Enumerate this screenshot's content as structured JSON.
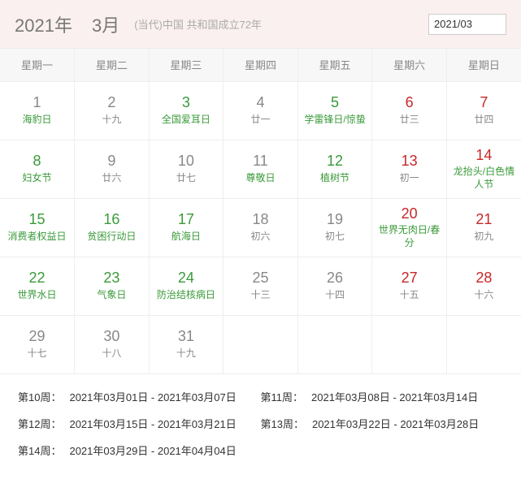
{
  "header": {
    "year": "2021年",
    "month": "3月",
    "subtitle": "(当代)中国 共和国成立72年",
    "input_value": "2021/03"
  },
  "weekdays": [
    "星期一",
    "星期二",
    "星期三",
    "星期四",
    "星期五",
    "星期六",
    "星期日"
  ],
  "rows": [
    [
      {
        "n": "1",
        "nc": "dark",
        "s": "海豹日",
        "sc": "green"
      },
      {
        "n": "2",
        "nc": "dark",
        "s": "十九",
        "sc": "dark"
      },
      {
        "n": "3",
        "nc": "green",
        "s": "全国爱耳日",
        "sc": "green"
      },
      {
        "n": "4",
        "nc": "dark",
        "s": "廿一",
        "sc": "dark"
      },
      {
        "n": "5",
        "nc": "green",
        "s": "学雷锋日/惊蛰",
        "sc": "green"
      },
      {
        "n": "6",
        "nc": "red",
        "s": "廿三",
        "sc": "dark"
      },
      {
        "n": "7",
        "nc": "red",
        "s": "廿四",
        "sc": "dark"
      }
    ],
    [
      {
        "n": "8",
        "nc": "green",
        "s": "妇女节",
        "sc": "green"
      },
      {
        "n": "9",
        "nc": "dark",
        "s": "廿六",
        "sc": "dark"
      },
      {
        "n": "10",
        "nc": "dark",
        "s": "廿七",
        "sc": "dark"
      },
      {
        "n": "11",
        "nc": "dark",
        "s": "尊敬日",
        "sc": "green"
      },
      {
        "n": "12",
        "nc": "green",
        "s": "植树节",
        "sc": "green"
      },
      {
        "n": "13",
        "nc": "red",
        "s": "初一",
        "sc": "dark"
      },
      {
        "n": "14",
        "nc": "red",
        "s": "龙抬头/白色情人节",
        "sc": "green"
      }
    ],
    [
      {
        "n": "15",
        "nc": "green",
        "s": "消费者权益日",
        "sc": "green"
      },
      {
        "n": "16",
        "nc": "green",
        "s": "贫困行动日",
        "sc": "green"
      },
      {
        "n": "17",
        "nc": "green",
        "s": "航海日",
        "sc": "green"
      },
      {
        "n": "18",
        "nc": "dark",
        "s": "初六",
        "sc": "dark"
      },
      {
        "n": "19",
        "nc": "dark",
        "s": "初七",
        "sc": "dark"
      },
      {
        "n": "20",
        "nc": "red",
        "s": "世界无肉日/春分",
        "sc": "green"
      },
      {
        "n": "21",
        "nc": "red",
        "s": "初九",
        "sc": "dark"
      }
    ],
    [
      {
        "n": "22",
        "nc": "green",
        "s": "世界水日",
        "sc": "green"
      },
      {
        "n": "23",
        "nc": "green",
        "s": "气象日",
        "sc": "green"
      },
      {
        "n": "24",
        "nc": "green",
        "s": "防治结核病日",
        "sc": "green"
      },
      {
        "n": "25",
        "nc": "dark",
        "s": "十三",
        "sc": "dark"
      },
      {
        "n": "26",
        "nc": "dark",
        "s": "十四",
        "sc": "dark"
      },
      {
        "n": "27",
        "nc": "red",
        "s": "十五",
        "sc": "dark"
      },
      {
        "n": "28",
        "nc": "red",
        "s": "十六",
        "sc": "dark"
      }
    ],
    [
      {
        "n": "29",
        "nc": "dark",
        "s": "十七",
        "sc": "dark"
      },
      {
        "n": "30",
        "nc": "dark",
        "s": "十八",
        "sc": "dark"
      },
      {
        "n": "31",
        "nc": "dark",
        "s": "十九",
        "sc": "dark"
      },
      {
        "n": "",
        "nc": "",
        "s": "",
        "sc": ""
      },
      {
        "n": "",
        "nc": "",
        "s": "",
        "sc": ""
      },
      {
        "n": "",
        "nc": "",
        "s": "",
        "sc": ""
      },
      {
        "n": "",
        "nc": "",
        "s": "",
        "sc": ""
      }
    ]
  ],
  "weeks": [
    [
      {
        "label": "第10周：",
        "range": "2021年03月01日 - 2021年03月07日"
      },
      {
        "label": "第11周：",
        "range": "2021年03月08日 - 2021年03月14日"
      }
    ],
    [
      {
        "label": "第12周：",
        "range": "2021年03月15日 - 2021年03月21日"
      },
      {
        "label": "第13周：",
        "range": "2021年03月22日 - 2021年03月28日"
      }
    ],
    [
      {
        "label": "第14周：",
        "range": "2021年03月29日 - 2021年04月04日"
      }
    ]
  ]
}
